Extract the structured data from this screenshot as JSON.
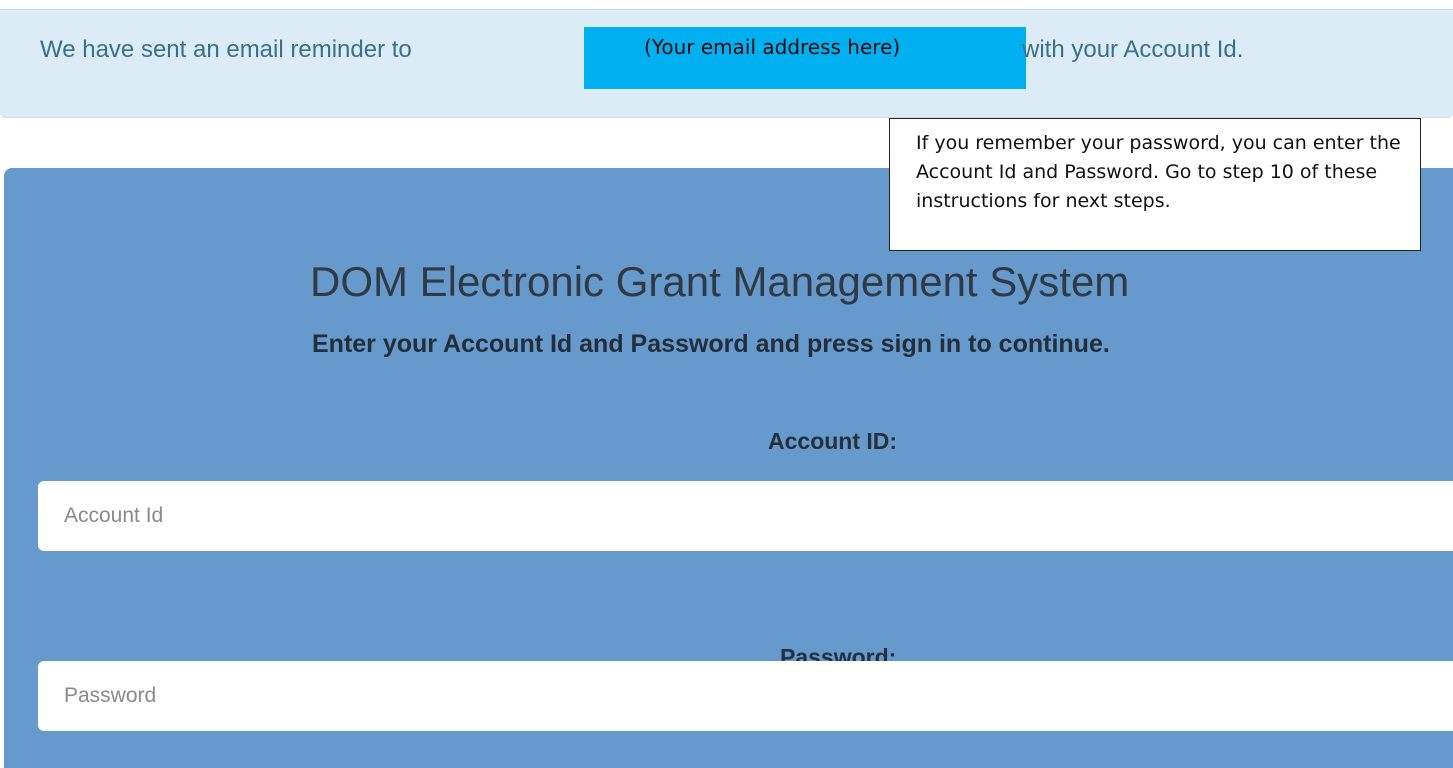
{
  "alert": {
    "text_before": "We have sent an email reminder to",
    "email_placeholder": "(Your email address here)",
    "text_after": "with your Account Id."
  },
  "callout": {
    "text": "If you remember your password, you can enter the Account Id and Password. Go to step 10 of these instructions for next steps."
  },
  "login": {
    "title": "DOM Electronic Grant Management System",
    "subtitle": "Enter your Account Id and Password and press sign in to continue.",
    "account_label": "Account ID:",
    "account_placeholder": "Account Id",
    "password_label": "Password:",
    "password_placeholder": "Password"
  },
  "colors": {
    "alert_bg": "#dcecf6",
    "alert_text": "#3a6f8e",
    "email_highlight": "#00b0f0",
    "panel_bg": "#6699cc"
  }
}
